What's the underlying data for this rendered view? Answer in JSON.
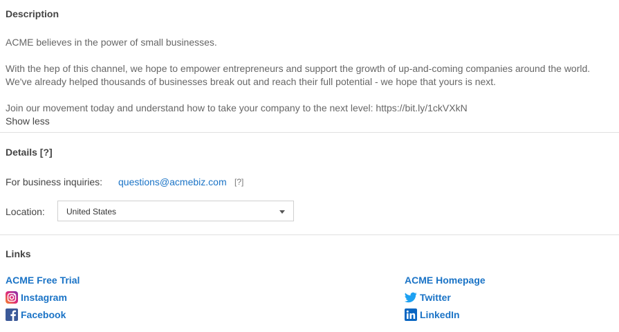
{
  "description": {
    "heading": "Description",
    "para1": "ACME believes in the power of small businesses.",
    "para2_line1": "With the hep of this channel, we hope to empower entrepreneurs and support the growth of up-and-coming companies around the world.",
    "para2_line2": "We've already helped thousands of businesses break out and reach their full potential - we hope that yours is next.",
    "para3": "Join our movement today and understand how to take your company to the next level: https://bit.ly/1ckVXkN",
    "toggle_label": "Show less"
  },
  "details": {
    "heading": "Details [?]",
    "business_label": "For business inquiries:",
    "business_email": "questions@acmebiz.com",
    "business_help": "[?]",
    "location_label": "Location:",
    "location_value": "United States"
  },
  "links": {
    "heading": "Links",
    "left": [
      {
        "label": "ACME Free Trial",
        "icon": ""
      },
      {
        "label": "Instagram",
        "icon": "instagram-icon"
      },
      {
        "label": "Facebook",
        "icon": "facebook-icon"
      }
    ],
    "right": [
      {
        "label": "ACME Homepage",
        "icon": ""
      },
      {
        "label": "Twitter",
        "icon": "twitter-icon"
      },
      {
        "label": "LinkedIn",
        "icon": "linkedin-icon"
      }
    ]
  },
  "colors": {
    "link": "#1a73c6",
    "facebook": "#3b5998",
    "twitter": "#1da1f2",
    "linkedin": "#0a66c2",
    "instagram": "#c13584"
  }
}
